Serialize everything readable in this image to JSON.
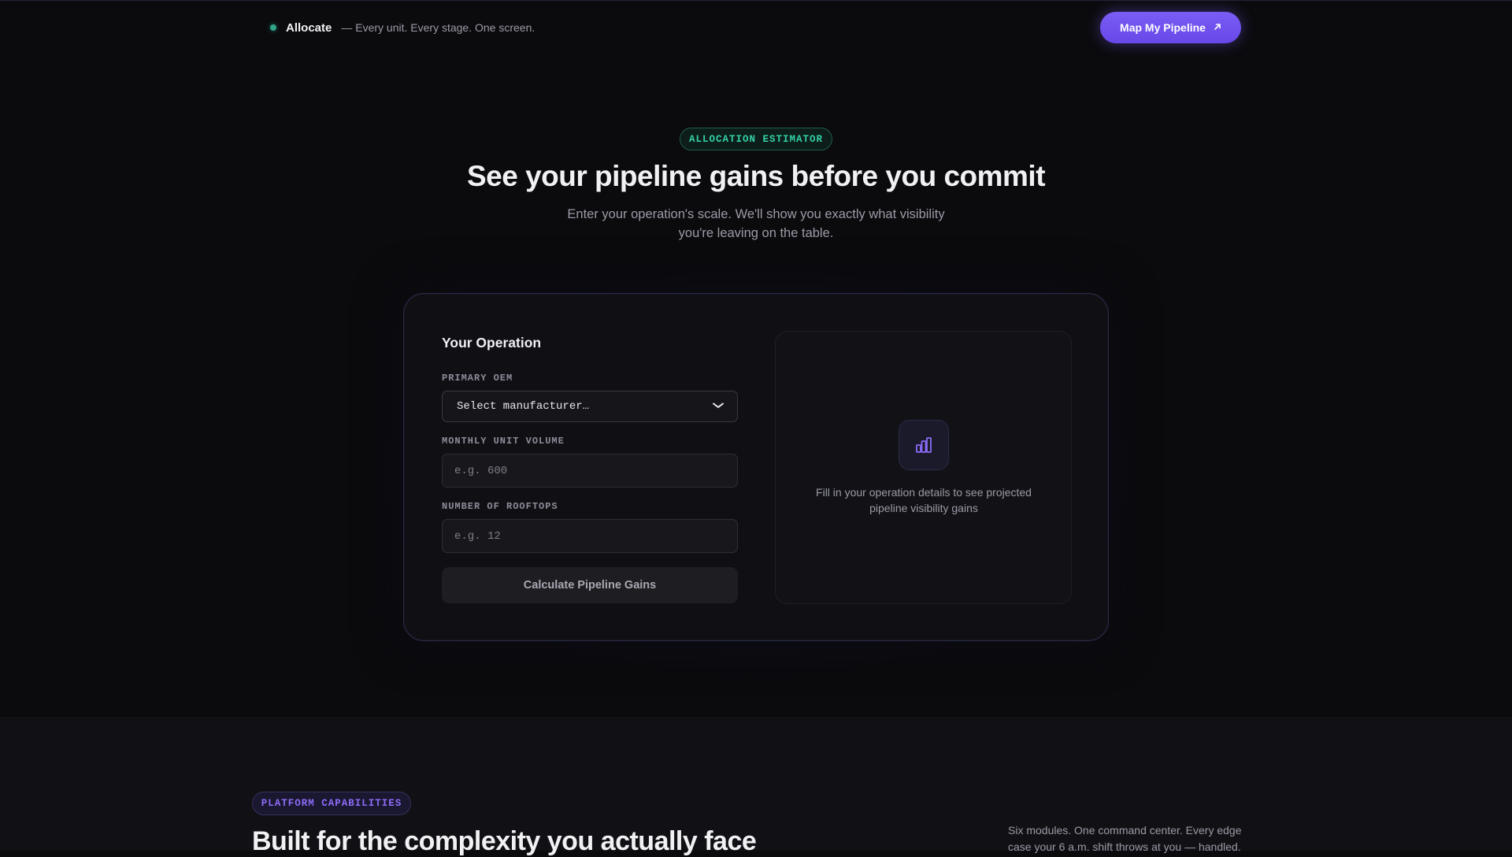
{
  "header": {
    "brand_name": "Allocate",
    "tagline": "— Every unit. Every stage. One screen.",
    "cta_label": "Map My Pipeline",
    "cta_icon": "arrow-up-right-icon"
  },
  "hero": {
    "badge": "ALLOCATION ESTIMATOR",
    "title": "See your pipeline gains before you commit",
    "subtitle": "Enter your operation's scale. We'll show you exactly what visibility you're leaving on the table."
  },
  "form": {
    "title": "Your Operation",
    "oem_label": "PRIMARY OEM",
    "oem_selected": "Select manufacturer…",
    "volume_label": "MONTHLY UNIT VOLUME",
    "volume_placeholder": "e.g. 600",
    "rooftops_label": "NUMBER OF ROOFTOPS",
    "rooftops_placeholder": "e.g. 12",
    "submit_label": "Calculate Pipeline Gains"
  },
  "results": {
    "icon": "bar-chart-icon",
    "empty_text": "Fill in your operation details to see projected pipeline visibility gains"
  },
  "platform": {
    "badge": "PLATFORM CAPABILITIES",
    "title": "Built for the complexity you actually face",
    "description": "Six modules. One command center. Every edge case your 6 a.m. shift throws at you — handled."
  },
  "colors": {
    "accent": "#7a5cf5",
    "teal": "#34d1a6",
    "background": "#0b0b0e"
  }
}
